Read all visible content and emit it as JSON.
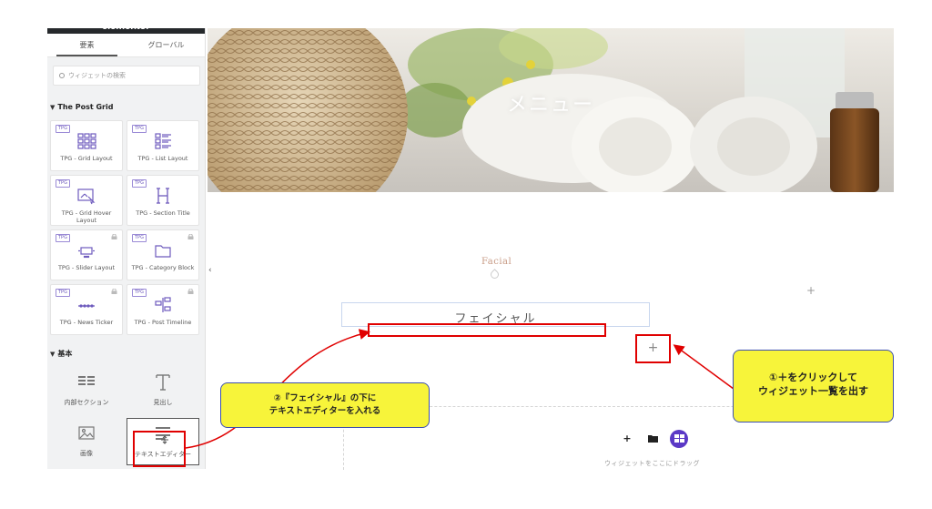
{
  "panel": {
    "logo": "elementor",
    "menu_dots": "•••",
    "tabs": [
      {
        "label": "要素"
      },
      {
        "label": "グローバル"
      }
    ],
    "search_placeholder": "ウィジェットの検索",
    "categories": {
      "post_grid": "The Post Grid",
      "basic": "基本"
    },
    "post_grid_widgets": [
      {
        "badge": "TPG",
        "label": "TPG - Grid Layout",
        "icon": "grid-layout-icon",
        "locked": false
      },
      {
        "badge": "TPG",
        "label": "TPG - List Layout",
        "icon": "list-layout-icon",
        "locked": false
      },
      {
        "badge": "TPG",
        "label": "TPG - Grid Hover Layout",
        "icon": "grid-hover-icon",
        "locked": false
      },
      {
        "badge": "TPG",
        "label": "TPG - Section Title",
        "icon": "section-title-icon",
        "locked": false
      },
      {
        "badge": "TPG",
        "label": "TPG - Slider Layout",
        "icon": "slider-layout-icon",
        "locked": true
      },
      {
        "badge": "TPG",
        "label": "TPG - Category Block",
        "icon": "category-block-icon",
        "locked": true
      },
      {
        "badge": "TPG",
        "label": "TPG - News Ticker",
        "icon": "news-ticker-icon",
        "locked": true
      },
      {
        "badge": "TPG",
        "label": "TPG - Post Timeline",
        "icon": "post-timeline-icon",
        "locked": true
      }
    ],
    "basic_widgets": [
      {
        "label": "内部セクション",
        "icon": "inner-section-icon"
      },
      {
        "label": "見出し",
        "icon": "heading-icon"
      },
      {
        "label": "画像",
        "icon": "image-icon"
      },
      {
        "label": "テキストエディター",
        "icon": "text-editor-icon"
      }
    ],
    "collapse_glyph": "‹"
  },
  "hero": {
    "title": "メニュー"
  },
  "canvas": {
    "section_label": "Facial",
    "top_plus": "+",
    "heading": "フェイシャル",
    "add_plus": "+",
    "dropzone": {
      "plus": "+",
      "text": "ウィジェットをここにドラッグ"
    }
  },
  "callouts": {
    "one": {
      "line1": "①＋をクリックして",
      "line2": "ウィジェット一覧を出す"
    },
    "two": {
      "line1": "②『フェイシャル』の下に",
      "line2": "テキストエディターを入れる"
    }
  },
  "colors": {
    "accent": "#5b39c6",
    "annotation_red": "#e00000",
    "callout_fill": "#f7f43a",
    "callout_border": "#3d4fb0",
    "section_label": "#c79a84"
  }
}
